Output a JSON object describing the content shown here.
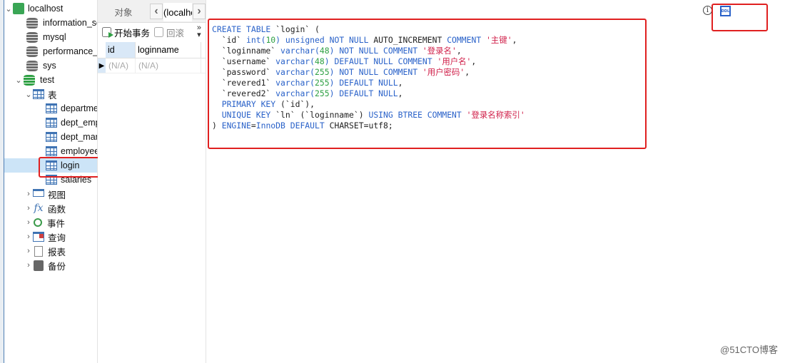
{
  "tree": {
    "connection": "localhost",
    "databases": [
      "information_schema",
      "mysql",
      "performance_schema",
      "sys"
    ],
    "active_db": "test",
    "tables_folder": "表",
    "tables": [
      "departments",
      "dept_emp",
      "dept_manager",
      "employees",
      "login",
      "salaries"
    ],
    "selected_table": "login",
    "folders": [
      {
        "label": "视图",
        "icon": "view-icon"
      },
      {
        "label": "函数",
        "icon": "function-icon"
      },
      {
        "label": "事件",
        "icon": "event-icon"
      },
      {
        "label": "查询",
        "icon": "query-icon"
      },
      {
        "label": "报表",
        "icon": "report-icon"
      },
      {
        "label": "备份",
        "icon": "backup-icon"
      }
    ]
  },
  "tabs": {
    "objects": "对象",
    "connection_tab": "(localhost)",
    "prev": "‹",
    "next": "›"
  },
  "toolbar": {
    "begin_transaction": "开始事务",
    "rollback": "回滚",
    "more": "»"
  },
  "grid": {
    "columns": [
      "id",
      "loginname"
    ],
    "rows": [
      [
        "(N/A)",
        "(N/A)"
      ]
    ]
  },
  "ddl": {
    "lines": [
      [
        {
          "t": "CREATE TABLE ",
          "c": "kw"
        },
        {
          "t": "`login` (",
          "c": ""
        }
      ],
      [
        {
          "t": "  `id` ",
          "c": ""
        },
        {
          "t": "int(",
          "c": "kw"
        },
        {
          "t": "10",
          "c": "num"
        },
        {
          "t": ") unsigned NOT NULL ",
          "c": "kw"
        },
        {
          "t": "AUTO_INCREMENT ",
          "c": ""
        },
        {
          "t": "COMMENT ",
          "c": "kw"
        },
        {
          "t": "'主键'",
          "c": "str"
        },
        {
          "t": ",",
          "c": ""
        }
      ],
      [
        {
          "t": "  `loginname` ",
          "c": ""
        },
        {
          "t": "varchar(",
          "c": "kw"
        },
        {
          "t": "48",
          "c": "num"
        },
        {
          "t": ") NOT NULL COMMENT ",
          "c": "kw"
        },
        {
          "t": "'登录名'",
          "c": "str"
        },
        {
          "t": ",",
          "c": ""
        }
      ],
      [
        {
          "t": "  `username` ",
          "c": ""
        },
        {
          "t": "varchar(",
          "c": "kw"
        },
        {
          "t": "48",
          "c": "num"
        },
        {
          "t": ") DEFAULT NULL COMMENT ",
          "c": "kw"
        },
        {
          "t": "'用户名'",
          "c": "str"
        },
        {
          "t": ",",
          "c": ""
        }
      ],
      [
        {
          "t": "  `password` ",
          "c": ""
        },
        {
          "t": "varchar(",
          "c": "kw"
        },
        {
          "t": "255",
          "c": "num"
        },
        {
          "t": ") NOT NULL COMMENT ",
          "c": "kw"
        },
        {
          "t": "'用户密码'",
          "c": "str"
        },
        {
          "t": ",",
          "c": ""
        }
      ],
      [
        {
          "t": "  `revered1` ",
          "c": ""
        },
        {
          "t": "varchar(",
          "c": "kw"
        },
        {
          "t": "255",
          "c": "num"
        },
        {
          "t": ") DEFAULT NULL",
          "c": "kw"
        },
        {
          "t": ",",
          "c": ""
        }
      ],
      [
        {
          "t": "  `revered2` ",
          "c": ""
        },
        {
          "t": "varchar(",
          "c": "kw"
        },
        {
          "t": "255",
          "c": "num"
        },
        {
          "t": ") DEFAULT NULL",
          "c": "kw"
        },
        {
          "t": ",",
          "c": ""
        }
      ],
      [
        {
          "t": "  PRIMARY KEY ",
          "c": "kw"
        },
        {
          "t": "(`id`),",
          "c": ""
        }
      ],
      [
        {
          "t": "  UNIQUE KEY ",
          "c": "kw"
        },
        {
          "t": "`ln` (`loginname`) ",
          "c": ""
        },
        {
          "t": "USING BTREE COMMENT ",
          "c": "kw"
        },
        {
          "t": "'登录名称索引'",
          "c": "str"
        }
      ],
      [
        {
          "t": ") ",
          "c": ""
        },
        {
          "t": "ENGINE",
          "c": "kw"
        },
        {
          "t": "=",
          "c": ""
        },
        {
          "t": "InnoDB DEFAULT ",
          "c": "kw"
        },
        {
          "t": "CHARSET=utf8;",
          "c": ""
        }
      ]
    ]
  },
  "right_icons": {
    "info": "i",
    "ddl": "DDL"
  },
  "watermark": "@51CTO博客",
  "colors": {
    "keyword": "#2a62c9",
    "number": "#2ea043",
    "string": "#d0204a",
    "highlight": "#e02020",
    "selection": "#cce4f7"
  }
}
